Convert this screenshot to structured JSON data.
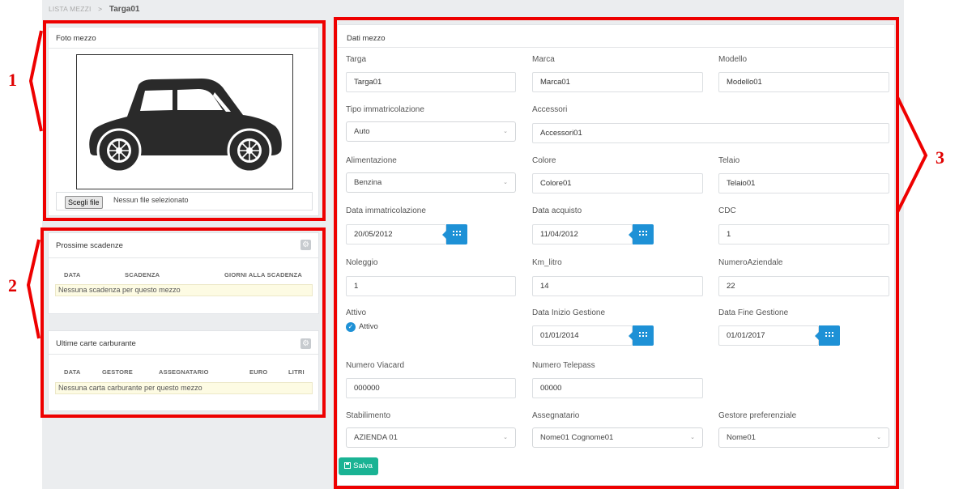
{
  "breadcrumb": {
    "parent": "LISTA MEZZI",
    "separator": ">",
    "current": "Targa01"
  },
  "foto": {
    "title": "Foto mezzo",
    "file_button": "Scegli file",
    "file_status": "Nessun file selezionato"
  },
  "scadenze": {
    "title": "Prossime scadenze",
    "columns": [
      "DATA",
      "SCADENZA",
      "GIORNI ALLA SCADENZA"
    ],
    "empty": "Nessuna scadenza per questo mezzo"
  },
  "carte": {
    "title": "Ultime carte carburante",
    "columns": [
      "DATA",
      "GESTORE",
      "ASSEGNATARIO",
      "EURO",
      "LITRI"
    ],
    "empty": "Nessuna carta carburante per questo mezzo"
  },
  "dati": {
    "title": "Dati mezzo",
    "targa": {
      "label": "Targa",
      "value": "Targa01"
    },
    "marca": {
      "label": "Marca",
      "value": "Marca01"
    },
    "modello": {
      "label": "Modello",
      "value": "Modello01"
    },
    "tipo": {
      "label": "Tipo immatricolazione",
      "value": "Auto"
    },
    "accessori": {
      "label": "Accessori",
      "value": "Accessori01"
    },
    "alimentazione": {
      "label": "Alimentazione",
      "value": "Benzina"
    },
    "colore": {
      "label": "Colore",
      "value": "Colore01"
    },
    "telaio": {
      "label": "Telaio",
      "value": "Telaio01"
    },
    "data_immatricolazione": {
      "label": "Data immatricolazione",
      "value": "20/05/2012"
    },
    "data_acquisto": {
      "label": "Data acquisto",
      "value": "11/04/2012"
    },
    "cdc": {
      "label": "CDC",
      "value": "1"
    },
    "noleggio": {
      "label": "Noleggio",
      "value": "1"
    },
    "km_litro": {
      "label": "Km_litro",
      "value": "14"
    },
    "numero_aziendale": {
      "label": "NumeroAziendale",
      "value": "22"
    },
    "attivo": {
      "label": "Attivo",
      "checkbox_label": "Attivo"
    },
    "data_inizio_gestione": {
      "label": "Data Inizio Gestione",
      "value": "01/01/2014"
    },
    "data_fine_gestione": {
      "label": "Data Fine Gestione",
      "value": "01/01/2017"
    },
    "numero_viacard": {
      "label": "Numero Viacard",
      "value": "000000"
    },
    "numero_telepass": {
      "label": "Numero Telepass",
      "value": "00000"
    },
    "stabilimento": {
      "label": "Stabilimento",
      "value": "AZIENDA 01"
    },
    "assegnatario": {
      "label": "Assegnatario",
      "value": "Nome01 Cognome01"
    },
    "gestore": {
      "label": "Gestore preferenziale",
      "value": "Nome01"
    },
    "save_label": "Salva"
  },
  "callouts": [
    "1",
    "2",
    "3"
  ],
  "colors": {
    "accent_blue": "#1e91d6",
    "save_green": "#1ab394",
    "callout_red": "#ee0000",
    "empty_row_bg": "#fdfbe3"
  }
}
